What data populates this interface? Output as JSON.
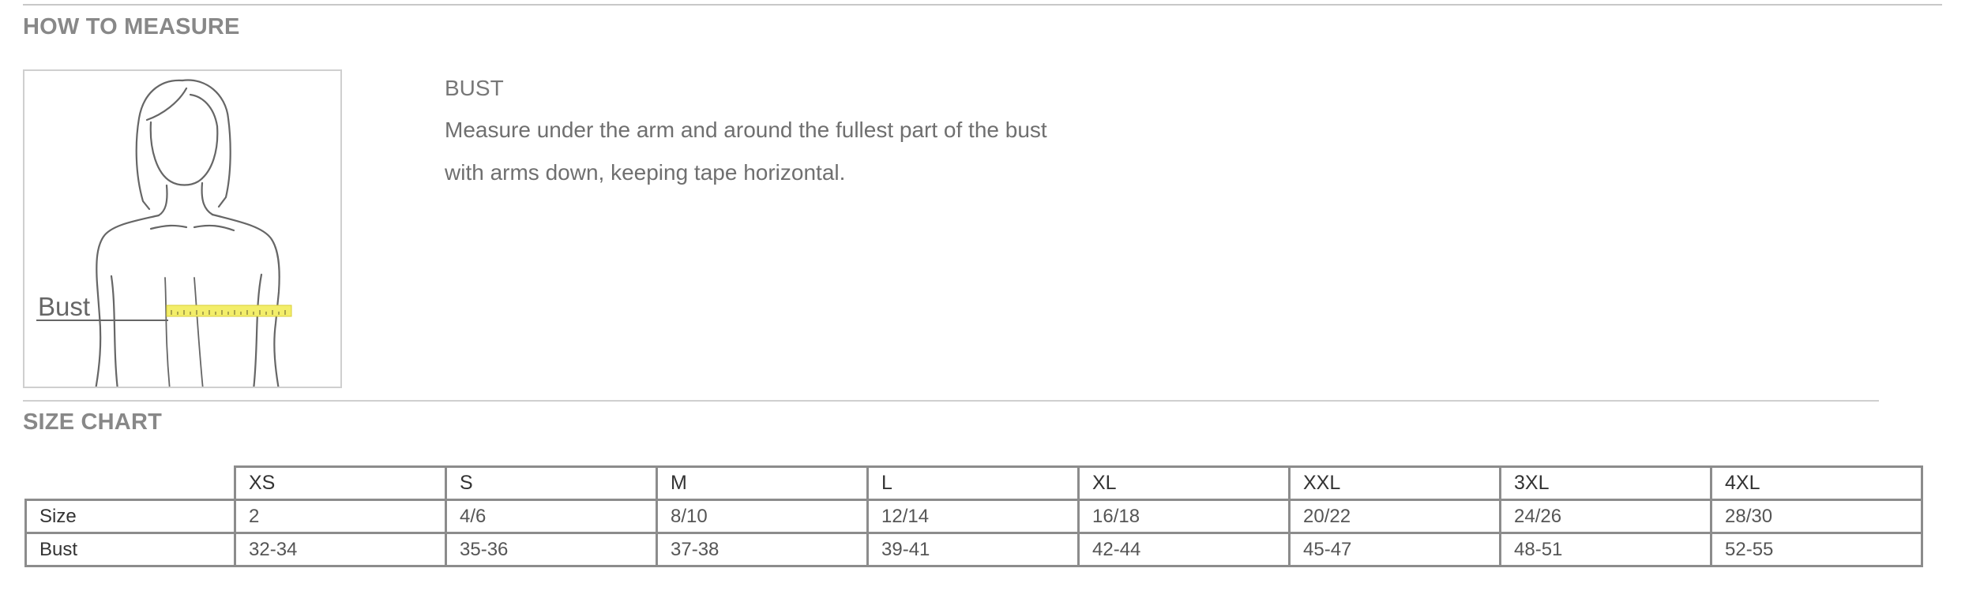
{
  "how_to_measure": {
    "title": "HOW TO MEASURE",
    "figure_label": "Bust",
    "measurement_title": "BUST",
    "description_lines": [
      "Measure under the arm and around the fullest part of the bust",
      "with arms down, keeping tape horizontal."
    ]
  },
  "size_chart": {
    "title": "SIZE CHART",
    "columns": [
      "XS",
      "S",
      "M",
      "L",
      "XL",
      "XXL",
      "3XL",
      "4XL"
    ],
    "rows": [
      {
        "label": "Size",
        "values": [
          "2",
          "4/6",
          "8/10",
          "12/14",
          "16/18",
          "20/22",
          "24/26",
          "28/30"
        ]
      },
      {
        "label": "Bust",
        "values": [
          "32-34",
          "35-36",
          "37-38",
          "39-41",
          "42-44",
          "45-47",
          "48-51",
          "52-55"
        ]
      }
    ]
  },
  "colors": {
    "tape": "#f3ee6a",
    "border": "#8c8c8c",
    "heading": "#888888"
  }
}
